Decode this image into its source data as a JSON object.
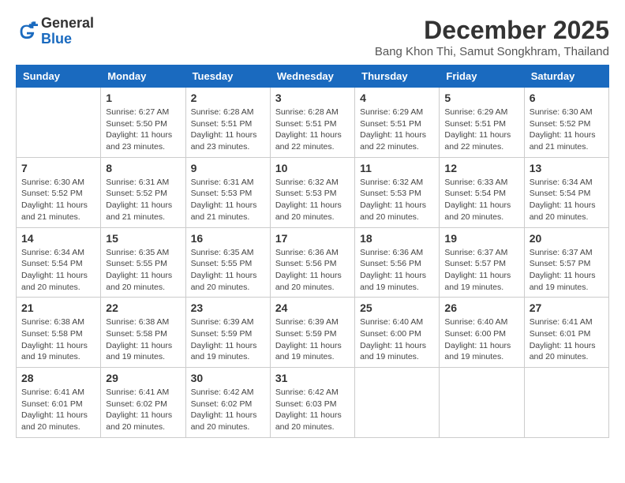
{
  "header": {
    "logo_general": "General",
    "logo_blue": "Blue",
    "month": "December 2025",
    "location": "Bang Khon Thi, Samut Songkhram, Thailand"
  },
  "days_of_week": [
    "Sunday",
    "Monday",
    "Tuesday",
    "Wednesday",
    "Thursday",
    "Friday",
    "Saturday"
  ],
  "weeks": [
    [
      {
        "day": "",
        "info": ""
      },
      {
        "day": "1",
        "info": "Sunrise: 6:27 AM\nSunset: 5:50 PM\nDaylight: 11 hours\nand 23 minutes."
      },
      {
        "day": "2",
        "info": "Sunrise: 6:28 AM\nSunset: 5:51 PM\nDaylight: 11 hours\nand 23 minutes."
      },
      {
        "day": "3",
        "info": "Sunrise: 6:28 AM\nSunset: 5:51 PM\nDaylight: 11 hours\nand 22 minutes."
      },
      {
        "day": "4",
        "info": "Sunrise: 6:29 AM\nSunset: 5:51 PM\nDaylight: 11 hours\nand 22 minutes."
      },
      {
        "day": "5",
        "info": "Sunrise: 6:29 AM\nSunset: 5:51 PM\nDaylight: 11 hours\nand 22 minutes."
      },
      {
        "day": "6",
        "info": "Sunrise: 6:30 AM\nSunset: 5:52 PM\nDaylight: 11 hours\nand 21 minutes."
      }
    ],
    [
      {
        "day": "7",
        "info": "Sunrise: 6:30 AM\nSunset: 5:52 PM\nDaylight: 11 hours\nand 21 minutes."
      },
      {
        "day": "8",
        "info": "Sunrise: 6:31 AM\nSunset: 5:52 PM\nDaylight: 11 hours\nand 21 minutes."
      },
      {
        "day": "9",
        "info": "Sunrise: 6:31 AM\nSunset: 5:53 PM\nDaylight: 11 hours\nand 21 minutes."
      },
      {
        "day": "10",
        "info": "Sunrise: 6:32 AM\nSunset: 5:53 PM\nDaylight: 11 hours\nand 20 minutes."
      },
      {
        "day": "11",
        "info": "Sunrise: 6:32 AM\nSunset: 5:53 PM\nDaylight: 11 hours\nand 20 minutes."
      },
      {
        "day": "12",
        "info": "Sunrise: 6:33 AM\nSunset: 5:54 PM\nDaylight: 11 hours\nand 20 minutes."
      },
      {
        "day": "13",
        "info": "Sunrise: 6:34 AM\nSunset: 5:54 PM\nDaylight: 11 hours\nand 20 minutes."
      }
    ],
    [
      {
        "day": "14",
        "info": "Sunrise: 6:34 AM\nSunset: 5:54 PM\nDaylight: 11 hours\nand 20 minutes."
      },
      {
        "day": "15",
        "info": "Sunrise: 6:35 AM\nSunset: 5:55 PM\nDaylight: 11 hours\nand 20 minutes."
      },
      {
        "day": "16",
        "info": "Sunrise: 6:35 AM\nSunset: 5:55 PM\nDaylight: 11 hours\nand 20 minutes."
      },
      {
        "day": "17",
        "info": "Sunrise: 6:36 AM\nSunset: 5:56 PM\nDaylight: 11 hours\nand 20 minutes."
      },
      {
        "day": "18",
        "info": "Sunrise: 6:36 AM\nSunset: 5:56 PM\nDaylight: 11 hours\nand 19 minutes."
      },
      {
        "day": "19",
        "info": "Sunrise: 6:37 AM\nSunset: 5:57 PM\nDaylight: 11 hours\nand 19 minutes."
      },
      {
        "day": "20",
        "info": "Sunrise: 6:37 AM\nSunset: 5:57 PM\nDaylight: 11 hours\nand 19 minutes."
      }
    ],
    [
      {
        "day": "21",
        "info": "Sunrise: 6:38 AM\nSunset: 5:58 PM\nDaylight: 11 hours\nand 19 minutes."
      },
      {
        "day": "22",
        "info": "Sunrise: 6:38 AM\nSunset: 5:58 PM\nDaylight: 11 hours\nand 19 minutes."
      },
      {
        "day": "23",
        "info": "Sunrise: 6:39 AM\nSunset: 5:59 PM\nDaylight: 11 hours\nand 19 minutes."
      },
      {
        "day": "24",
        "info": "Sunrise: 6:39 AM\nSunset: 5:59 PM\nDaylight: 11 hours\nand 19 minutes."
      },
      {
        "day": "25",
        "info": "Sunrise: 6:40 AM\nSunset: 6:00 PM\nDaylight: 11 hours\nand 19 minutes."
      },
      {
        "day": "26",
        "info": "Sunrise: 6:40 AM\nSunset: 6:00 PM\nDaylight: 11 hours\nand 19 minutes."
      },
      {
        "day": "27",
        "info": "Sunrise: 6:41 AM\nSunset: 6:01 PM\nDaylight: 11 hours\nand 20 minutes."
      }
    ],
    [
      {
        "day": "28",
        "info": "Sunrise: 6:41 AM\nSunset: 6:01 PM\nDaylight: 11 hours\nand 20 minutes."
      },
      {
        "day": "29",
        "info": "Sunrise: 6:41 AM\nSunset: 6:02 PM\nDaylight: 11 hours\nand 20 minutes."
      },
      {
        "day": "30",
        "info": "Sunrise: 6:42 AM\nSunset: 6:02 PM\nDaylight: 11 hours\nand 20 minutes."
      },
      {
        "day": "31",
        "info": "Sunrise: 6:42 AM\nSunset: 6:03 PM\nDaylight: 11 hours\nand 20 minutes."
      },
      {
        "day": "",
        "info": ""
      },
      {
        "day": "",
        "info": ""
      },
      {
        "day": "",
        "info": ""
      }
    ]
  ]
}
